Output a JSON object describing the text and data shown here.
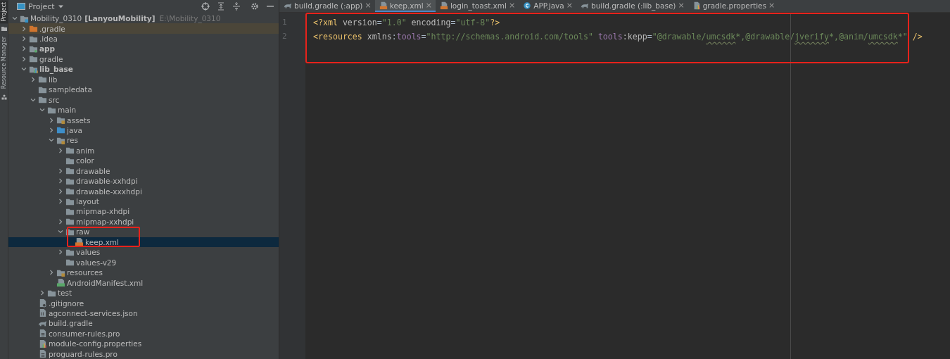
{
  "tool_strip": [
    {
      "label": "Project",
      "selected": true
    },
    {
      "label": "Resource Manager",
      "selected": false
    }
  ],
  "project_panel": {
    "title": "Project",
    "tree": [
      {
        "label": "Mobility_0310",
        "module": "[LanyouMobility]",
        "path": "E:\\Mobility_0310",
        "kind": "module",
        "expanded": true,
        "selected": false,
        "children": [
          {
            "label": ".gradle",
            "kind": "folder-excluded",
            "expanded": false,
            "excluded": true,
            "selected": false
          },
          {
            "label": ".idea",
            "kind": "folder",
            "expanded": false,
            "selected": false
          },
          {
            "label": "app",
            "kind": "module-app",
            "bold": true,
            "expanded": false,
            "selected": false
          },
          {
            "label": "gradle",
            "kind": "folder",
            "expanded": false,
            "selected": false
          },
          {
            "label": "lib_base",
            "kind": "module-lib",
            "bold": true,
            "expanded": true,
            "selected": false,
            "children": [
              {
                "label": "lib",
                "kind": "folder",
                "expanded": false,
                "selected": false
              },
              {
                "label": "sampledata",
                "kind": "folder",
                "selected": false
              },
              {
                "label": "src",
                "kind": "folder",
                "expanded": true,
                "selected": false,
                "children": [
                  {
                    "label": "main",
                    "kind": "folder",
                    "expanded": true,
                    "selected": false,
                    "children": [
                      {
                        "label": "assets",
                        "kind": "res-folder",
                        "expanded": false,
                        "selected": false
                      },
                      {
                        "label": "java",
                        "kind": "source-folder",
                        "expanded": false,
                        "selected": false
                      },
                      {
                        "label": "res",
                        "kind": "res-folder",
                        "expanded": true,
                        "selected": false,
                        "children": [
                          {
                            "label": "anim",
                            "kind": "folder",
                            "expanded": false,
                            "selected": false
                          },
                          {
                            "label": "color",
                            "kind": "folder",
                            "selected": false
                          },
                          {
                            "label": "drawable",
                            "kind": "folder",
                            "expanded": false,
                            "selected": false
                          },
                          {
                            "label": "drawable-xxhdpi",
                            "kind": "folder",
                            "expanded": false,
                            "selected": false
                          },
                          {
                            "label": "drawable-xxxhdpi",
                            "kind": "folder",
                            "expanded": false,
                            "selected": false
                          },
                          {
                            "label": "layout",
                            "kind": "folder",
                            "expanded": false,
                            "selected": false
                          },
                          {
                            "label": "mipmap-xhdpi",
                            "kind": "folder",
                            "selected": false
                          },
                          {
                            "label": "mipmap-xxhdpi",
                            "kind": "folder",
                            "expanded": false,
                            "selected": false
                          },
                          {
                            "label": "raw",
                            "kind": "folder",
                            "expanded": true,
                            "boxed": true,
                            "selected": false,
                            "children": [
                              {
                                "label": "keep.xml",
                                "kind": "xml",
                                "selected": true
                              }
                            ]
                          },
                          {
                            "label": "values",
                            "kind": "folder",
                            "expanded": false,
                            "selected": false
                          },
                          {
                            "label": "values-v29",
                            "kind": "folder",
                            "selected": false
                          }
                        ]
                      },
                      {
                        "label": "resources",
                        "kind": "res-folder",
                        "expanded": false,
                        "selected": false
                      },
                      {
                        "label": "AndroidManifest.xml",
                        "kind": "manifest",
                        "selected": false
                      }
                    ]
                  },
                  {
                    "label": "test",
                    "kind": "folder",
                    "expanded": false,
                    "selected": false
                  }
                ]
              },
              {
                "label": ".gitignore",
                "kind": "ignore",
                "selected": false
              },
              {
                "label": "agconnect-services.json",
                "kind": "json",
                "selected": false
              },
              {
                "label": "build.gradle",
                "kind": "gradle",
                "selected": false
              },
              {
                "label": "consumer-rules.pro",
                "kind": "text",
                "selected": false
              },
              {
                "label": "module-config.properties",
                "kind": "properties",
                "selected": false
              },
              {
                "label": "proguard-rules.pro",
                "kind": "text",
                "selected": false
              }
            ]
          }
        ]
      }
    ]
  },
  "editor": {
    "tabs": [
      {
        "label": "build.gradle (:app)",
        "kind": "gradle",
        "selected": false
      },
      {
        "label": "keep.xml",
        "kind": "xml",
        "selected": true
      },
      {
        "label": "login_toast.xml",
        "kind": "xml",
        "selected": false
      },
      {
        "label": "APP.java",
        "kind": "java",
        "selected": false
      },
      {
        "label": "build.gradle (:lib_base)",
        "kind": "gradle",
        "selected": false
      },
      {
        "label": "gradle.properties",
        "kind": "properties",
        "selected": false
      }
    ],
    "close_glyph": "×",
    "boxed": true,
    "lines": [
      {
        "number": "1",
        "tokens": [
          {
            "text": "<?xml",
            "kind": "tag"
          },
          {
            "text": " version",
            "kind": "attr"
          },
          {
            "text": "=",
            "kind": "plain"
          },
          {
            "text": "\"1.0\"",
            "kind": "value"
          },
          {
            "text": " encoding",
            "kind": "attr"
          },
          {
            "text": "=",
            "kind": "plain"
          },
          {
            "text": "\"utf-8\"",
            "kind": "value"
          },
          {
            "text": "?>",
            "kind": "tag"
          }
        ]
      },
      {
        "number": "2",
        "tokens": [
          {
            "text": "<resources",
            "kind": "tag"
          },
          {
            "text": " xmlns",
            "kind": "attr"
          },
          {
            "text": ":",
            "kind": "plain"
          },
          {
            "text": "tools",
            "kind": "ns"
          },
          {
            "text": "=",
            "kind": "plain"
          },
          {
            "text": "\"http://schemas.android.com/tools\"",
            "kind": "value"
          },
          {
            "text": " tools",
            "kind": "ns"
          },
          {
            "text": ":kepp",
            "kind": "attr"
          },
          {
            "text": "=",
            "kind": "plain"
          },
          {
            "text": "\"@drawable/",
            "kind": "value"
          },
          {
            "text": "umcsdk",
            "kind": "typo"
          },
          {
            "text": "*,@drawable/",
            "kind": "value"
          },
          {
            "text": "jverify",
            "kind": "typo"
          },
          {
            "text": "*,@anim/",
            "kind": "value"
          },
          {
            "text": "umcsdk",
            "kind": "typo"
          },
          {
            "text": "*\"",
            "kind": "value"
          },
          {
            "text": " />",
            "kind": "tag"
          }
        ]
      }
    ]
  }
}
